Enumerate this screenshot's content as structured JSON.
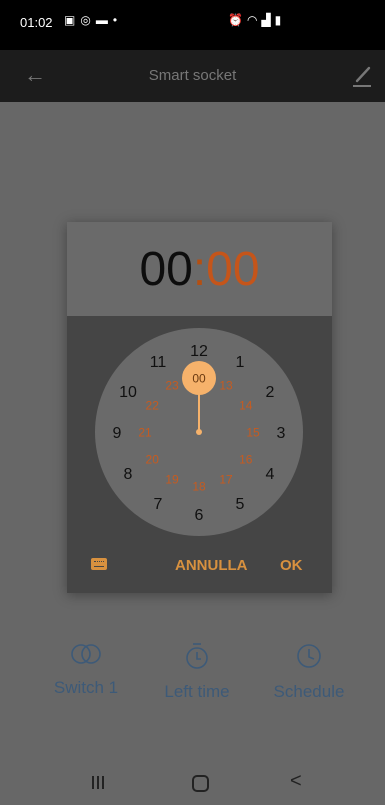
{
  "statusbar": {
    "time": "01:02",
    "left_icons": [
      "image-icon",
      "location-icon",
      "sms-icon",
      "dot-icon"
    ],
    "right_icons": [
      "alarm-icon",
      "wifi-icon",
      "signal-icon",
      "battery-icon"
    ]
  },
  "appbar": {
    "title": "Smart socket",
    "back_icon": "back-arrow-icon",
    "edit_icon": "edit-icon"
  },
  "time_picker": {
    "hours": "00",
    "separator": ":",
    "minutes": "00",
    "selected_hour": "00",
    "outer_ring": [
      "12",
      "1",
      "2",
      "3",
      "4",
      "5",
      "6",
      "7",
      "8",
      "9",
      "10",
      "11"
    ],
    "inner_ring": [
      "00",
      "13",
      "14",
      "15",
      "16",
      "17",
      "18",
      "19",
      "20",
      "21",
      "22",
      "23"
    ],
    "cancel_label": "ANNULLA",
    "ok_label": "OK",
    "colors": {
      "accent": "#d8913f",
      "selected_circle": "#f6b26b",
      "inner_numbers": "#c65b20",
      "outer_numbers": "#101010",
      "dial_face": "#6a6a6a",
      "body": "#454545"
    }
  },
  "tabs": [
    {
      "label": "Switch 1",
      "icon": "toggle-circles-icon"
    },
    {
      "label": "Left time",
      "icon": "timer-icon"
    },
    {
      "label": "Schedule",
      "icon": "clock-icon"
    }
  ],
  "navbar": {
    "recent_icon": "recent-apps-icon",
    "home_icon": "home-icon",
    "back_icon": "nav-back-icon"
  }
}
